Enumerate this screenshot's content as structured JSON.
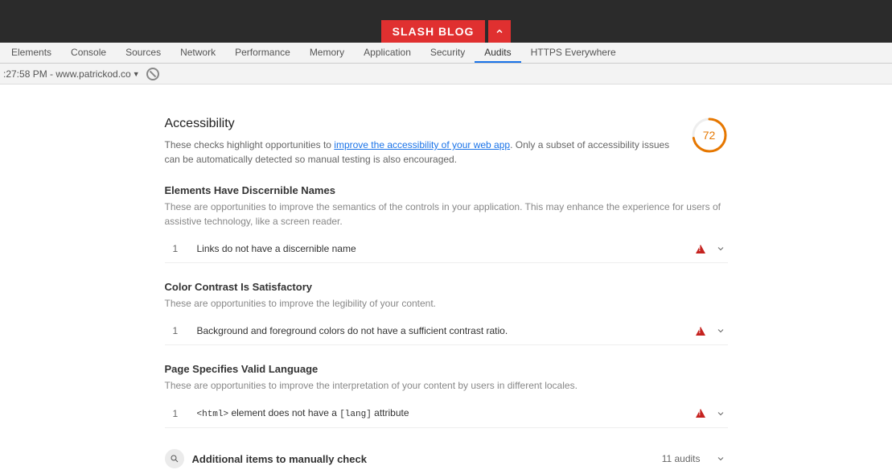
{
  "header": {
    "brand": "SLASH BLOG"
  },
  "tabs": [
    "Elements",
    "Console",
    "Sources",
    "Network",
    "Performance",
    "Memory",
    "Application",
    "Security",
    "Audits",
    "HTTPS Everywhere"
  ],
  "active_tab": "Audits",
  "toolbar": {
    "dropdown": ":27:58 PM - www.patrickod.co"
  },
  "section": {
    "title": "Accessibility",
    "score": 72,
    "desc_prefix": "These checks highlight opportunities to ",
    "desc_link": "improve the accessibility of your web app",
    "desc_suffix": ". Only a subset of accessibility issues can be automatically detected so manual testing is also encouraged."
  },
  "groups": [
    {
      "title": "Elements Have Discernible Names",
      "desc": "These are opportunities to improve the semantics of the controls in your application. This may enhance the experience for users of assistive technology, like a screen reader.",
      "audits": [
        {
          "num": "1",
          "title": "Links do not have a discernible name",
          "code": false
        }
      ]
    },
    {
      "title": "Color Contrast Is Satisfactory",
      "desc": "These are opportunities to improve the legibility of your content.",
      "audits": [
        {
          "num": "1",
          "title": "Background and foreground colors do not have a sufficient contrast ratio.",
          "code": false
        }
      ]
    },
    {
      "title": "Page Specifies Valid Language",
      "desc": "These are opportunities to improve the interpretation of your content by users in different locales.",
      "audits": [
        {
          "num": "1",
          "title_html": "<code>&lt;html&gt;</code> element does not have a <code>[lang]</code> attribute",
          "code": true
        }
      ]
    }
  ],
  "manual": {
    "title": "Additional items to manually check",
    "count": "11 audits"
  }
}
